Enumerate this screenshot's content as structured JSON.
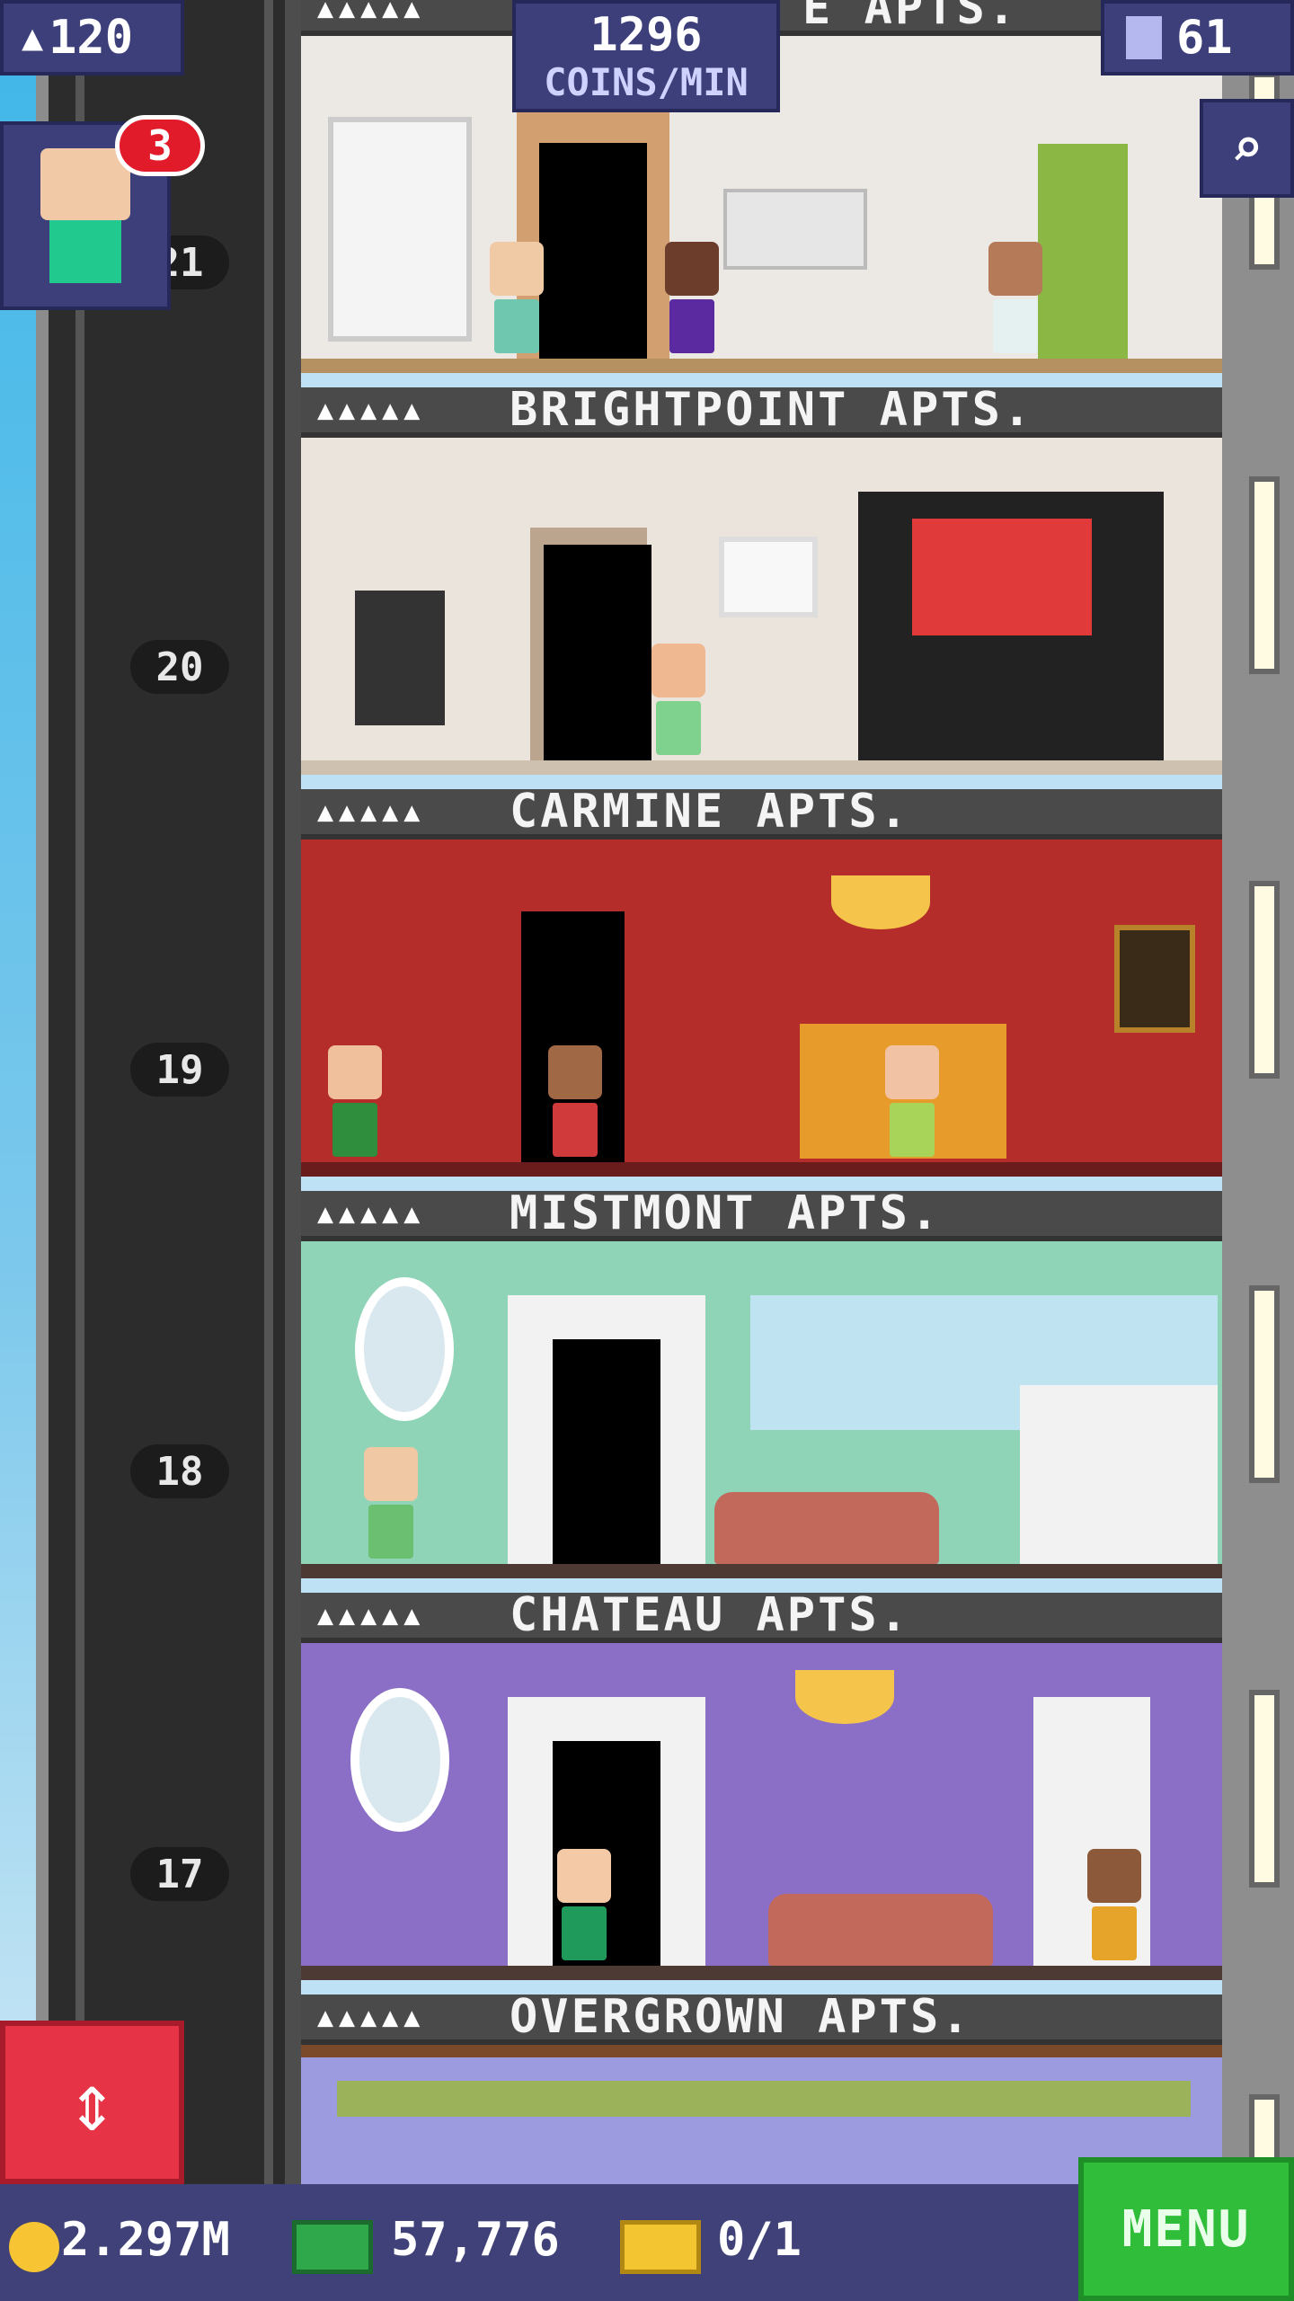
{
  "hud": {
    "population": "120",
    "coins_per_min_value": "1296",
    "coins_per_min_label": "COINS/MIN",
    "floors_count": "61",
    "notification_count": "3"
  },
  "floors": [
    {
      "name": "E APTS.",
      "number": "21",
      "stars": "▲▲▲▲▲"
    },
    {
      "name": "BRIGHTPOINT APTS.",
      "number": "20",
      "stars": "▲▲▲▲▲"
    },
    {
      "name": "CARMINE APTS.",
      "number": "19",
      "stars": "▲▲▲▲▲"
    },
    {
      "name": "MISTMONT APTS.",
      "number": "18",
      "stars": "▲▲▲▲▲"
    },
    {
      "name": "CHATEAU APTS.",
      "number": "17",
      "stars": "▲▲▲▲▲"
    },
    {
      "name": "OVERGROWN APTS.",
      "number": "",
      "stars": "▲▲▲▲▲"
    }
  ],
  "bottom_bar": {
    "coins": "2.297M",
    "bux": "57,776",
    "tickets": "0/1",
    "menu_label": "MENU"
  },
  "colors": {
    "hud_bg": "#3d3f7a",
    "menu_green": "#2fbd3a",
    "elevator_red": "#e63446",
    "badge_red": "#e21b2b"
  },
  "icons": [
    "population-icon",
    "floors-icon",
    "search-icon",
    "elevator-icon",
    "coin-icon",
    "bux-icon",
    "ticket-icon"
  ]
}
